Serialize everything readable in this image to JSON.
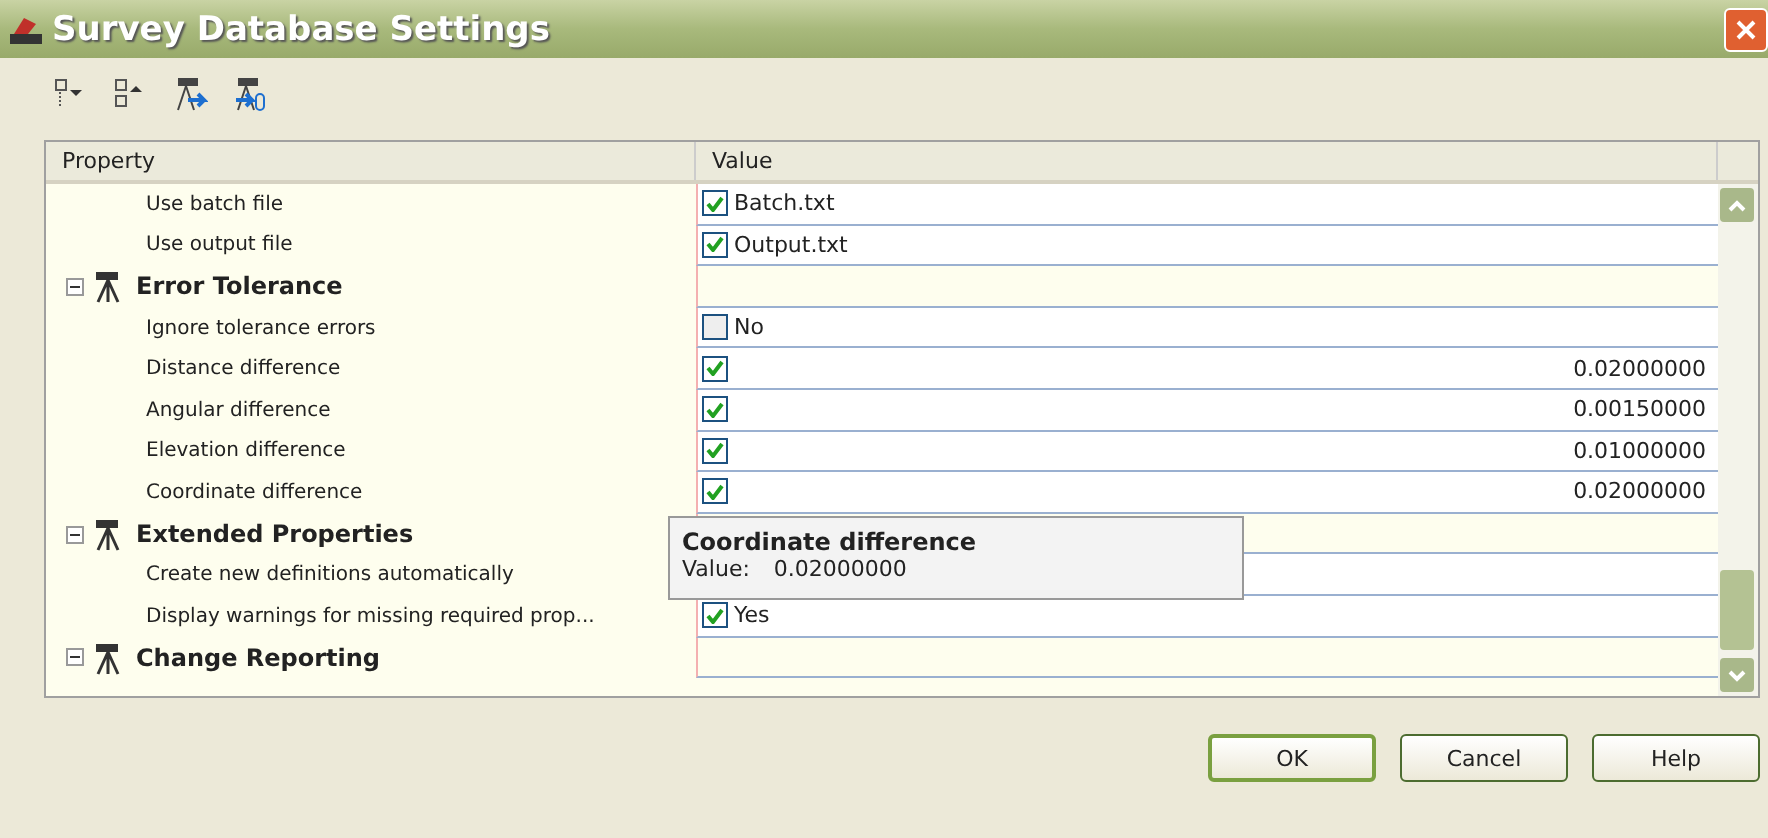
{
  "window": {
    "title": "Survey Database Settings"
  },
  "toolbar": [
    {
      "kind": "expand"
    },
    {
      "kind": "collapse"
    },
    {
      "kind": "export"
    },
    {
      "kind": "import"
    }
  ],
  "grid": {
    "columns": [
      "Property",
      "Value"
    ],
    "rows": [
      {
        "kind": "item",
        "label": "Use batch file",
        "checked": true,
        "text": "Batch.txt"
      },
      {
        "kind": "item",
        "label": "Use output file",
        "checked": true,
        "text": "Output.txt"
      },
      {
        "kind": "category",
        "label": "Error Tolerance",
        "expanded": true
      },
      {
        "kind": "item",
        "label": "Ignore tolerance errors",
        "checked": false,
        "text": "No"
      },
      {
        "kind": "item",
        "label": "Distance difference",
        "checked": true,
        "number": "0.02000000"
      },
      {
        "kind": "item",
        "label": "Angular difference",
        "checked": true,
        "number": "0.00150000"
      },
      {
        "kind": "item",
        "label": "Elevation difference",
        "checked": true,
        "number": "0.01000000"
      },
      {
        "kind": "item",
        "label": "Coordinate difference",
        "checked": true,
        "number": "0.02000000"
      },
      {
        "kind": "category",
        "label": "Extended Properties",
        "expanded": true
      },
      {
        "kind": "item",
        "label": "Create new definitions automatically"
      },
      {
        "kind": "item",
        "label": "Display warnings for missing required prop...",
        "checked": true,
        "text": "Yes"
      },
      {
        "kind": "category",
        "label": "Change Reporting",
        "expanded": true
      }
    ]
  },
  "tooltip": {
    "title": "Coordinate difference",
    "label": "Value:",
    "value": "0.02000000"
  },
  "buttons": [
    {
      "label": "OK",
      "default": true
    },
    {
      "label": "Cancel",
      "default": false
    },
    {
      "label": "Help",
      "default": false
    }
  ]
}
